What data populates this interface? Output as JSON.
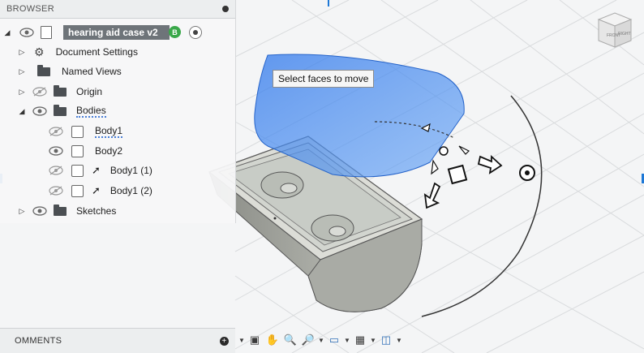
{
  "browser": {
    "header": "BROWSER",
    "root_label": "hearing aid case v2",
    "root_badge": "B",
    "items": [
      {
        "label": "Document Settings"
      },
      {
        "label": "Named Views"
      },
      {
        "label": "Origin"
      },
      {
        "label": "Bodies"
      },
      {
        "label": "Body1"
      },
      {
        "label": "Body2"
      },
      {
        "label": "Body1 (1)"
      },
      {
        "label": "Body1 (2)"
      },
      {
        "label": "Sketches"
      }
    ]
  },
  "tooltip": "Select faces to move",
  "comments": {
    "label": "OMMENTS"
  },
  "viewcube": {
    "face_front": "FRONT",
    "face_right": "RIGHT"
  },
  "icons": [
    "eye-icon",
    "folder-icon",
    "gear-icon",
    "body-icon",
    "move-arrow-icon",
    "orbit-icon",
    "pan-icon",
    "zoom-icon",
    "display-icon",
    "grid-icon",
    "viewport-icon"
  ],
  "colors": {
    "selection_blue": "#3d86f0",
    "root_bar": "#6e7479",
    "badge": "#3aa84a"
  }
}
